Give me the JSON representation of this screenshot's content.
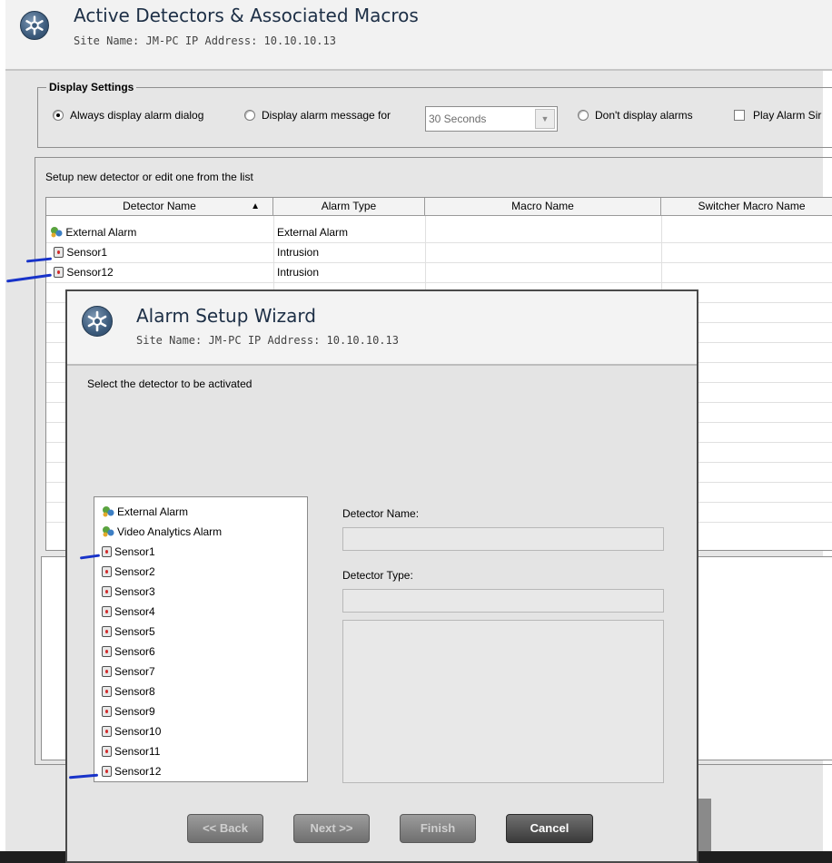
{
  "main": {
    "title": "Active Detectors & Associated Macros",
    "subtitle": "Site Name: JM-PC   IP Address: 10.10.10.13",
    "display_settings": {
      "legend": "Display Settings",
      "opt_always": "Always display alarm dialog",
      "opt_display_for": "Display alarm message for",
      "duration_value": "30 Seconds",
      "opt_dont": "Don't display alarms",
      "chk_play": "Play Alarm Sir"
    },
    "setup_label": "Setup new detector or edit one from the  list",
    "table": {
      "headers": [
        "Detector Name",
        "Alarm Type",
        "Macro Name",
        "Switcher Macro Name"
      ],
      "rows": [
        {
          "name": "External Alarm",
          "type": "External Alarm",
          "icon": "external-alarm-icon"
        },
        {
          "name": "Sensor1",
          "type": "Intrusion",
          "icon": "sensor-icon"
        },
        {
          "name": "Sensor12",
          "type": "Intrusion",
          "icon": "sensor-icon"
        }
      ]
    }
  },
  "wizard": {
    "title": "Alarm Setup Wizard",
    "subtitle": "Site Name: JM-PC   IP Address: 10.10.10.13",
    "instruction": "Select the detector to be activated",
    "detector_name_label": "Detector Name:",
    "detector_type_label": "Detector Type:",
    "tree": [
      "External Alarm",
      "Video Analytics Alarm",
      "Sensor1",
      "Sensor2",
      "Sensor3",
      "Sensor4",
      "Sensor5",
      "Sensor6",
      "Sensor7",
      "Sensor8",
      "Sensor9",
      "Sensor10",
      "Sensor11",
      "Sensor12"
    ],
    "buttons": {
      "back": "<< Back",
      "next": "Next >>",
      "finish": "Finish",
      "cancel": "Cancel"
    }
  },
  "colors": {
    "title_text": "#1d2f46",
    "annotation_mark": "#1833c9",
    "sensor_led": "#d12a2a"
  }
}
